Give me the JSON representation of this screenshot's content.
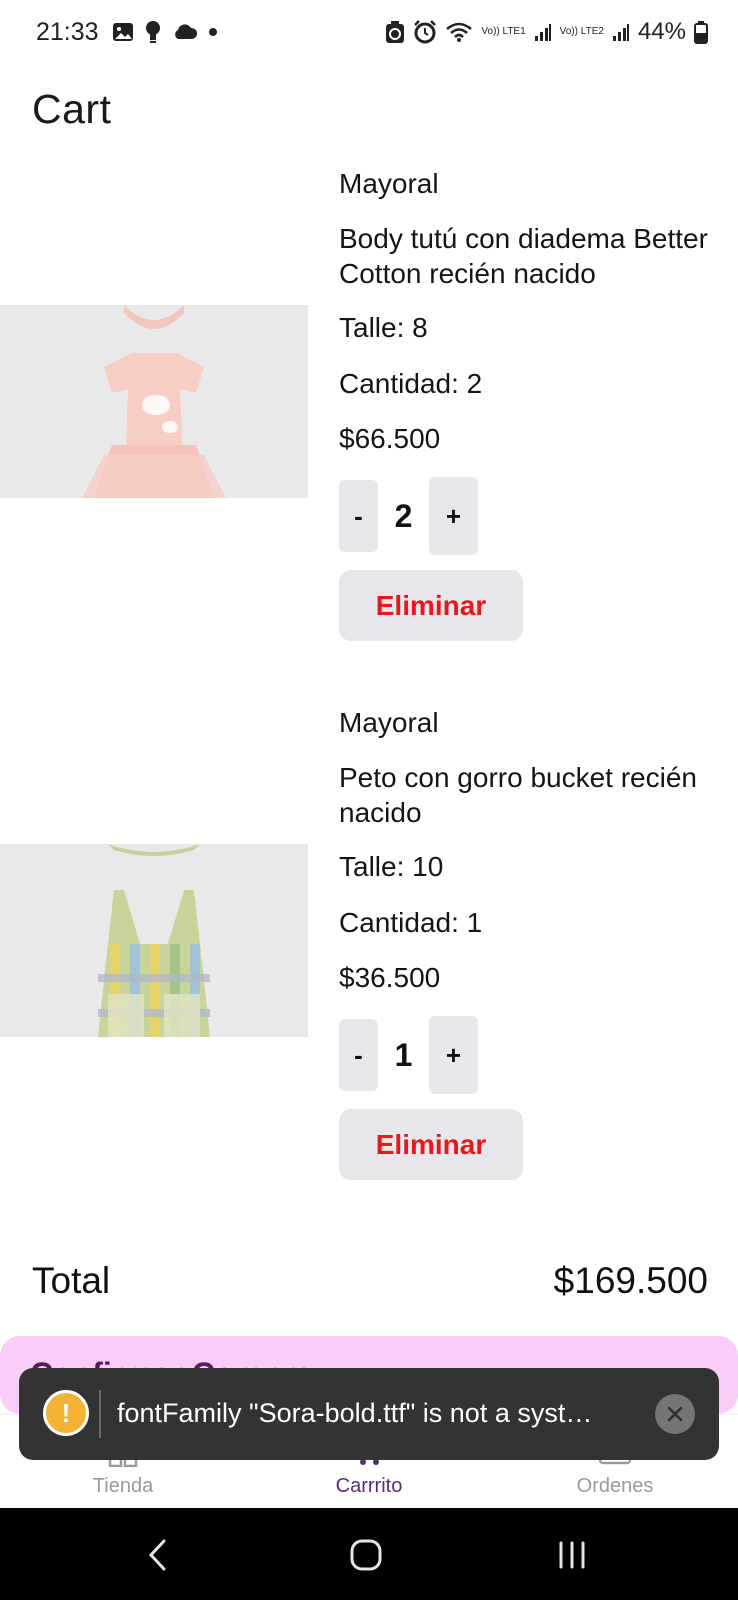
{
  "status_bar": {
    "time": "21:33",
    "battery": "44%",
    "network_1": "Vo)) LTE1",
    "network_2": "Vo)) LTE2",
    "left_icons": [
      "image-icon",
      "lightbulb-icon",
      "cloud-icon",
      "dot-icon"
    ],
    "right_icons": [
      "recycle-icon",
      "alarm-icon",
      "wifi-icon",
      "signal-icon",
      "signal-icon",
      "battery-icon"
    ]
  },
  "page": {
    "title": "Cart"
  },
  "cart": {
    "items": [
      {
        "brand": "Mayoral",
        "name": "Body tutú con diadema Better Cotton recién nacido",
        "size": "Talle: 8",
        "quantity_label": "Cantidad: 2",
        "price": "$66.500",
        "stepper": {
          "minus": "-",
          "value": "2",
          "plus": "+"
        },
        "delete_label": "Eliminar",
        "image": "pink-tutu-bodysuit"
      },
      {
        "brand": "Mayoral",
        "name": "Peto con gorro bucket recién nacido",
        "size": "Talle: 10",
        "quantity_label": "Cantidad: 1",
        "price": "$36.500",
        "stepper": {
          "minus": "-",
          "value": "1",
          "plus": "+"
        },
        "delete_label": "Eliminar",
        "image": "plaid-overalls"
      }
    ]
  },
  "total": {
    "label": "Total",
    "value": "$169.500"
  },
  "confirm": {
    "label": "Confirmar Compra"
  },
  "toast": {
    "message": "fontFamily \"Sora-bold.ttf\" is not a syst…"
  },
  "bottom_nav": {
    "items": [
      {
        "label": "Tienda",
        "icon": "grid-icon",
        "active": false
      },
      {
        "label": "Carrrito",
        "icon": "cart-icon",
        "active": true
      },
      {
        "label": "Ordenes",
        "icon": "orders-icon",
        "active": false
      }
    ]
  },
  "colors": {
    "accent": "#5b2c6f",
    "confirm_bg": "#f9ccf9",
    "delete_text": "#e8171c",
    "button_bg": "#e6e7ea",
    "toast_bg": "#333333"
  }
}
